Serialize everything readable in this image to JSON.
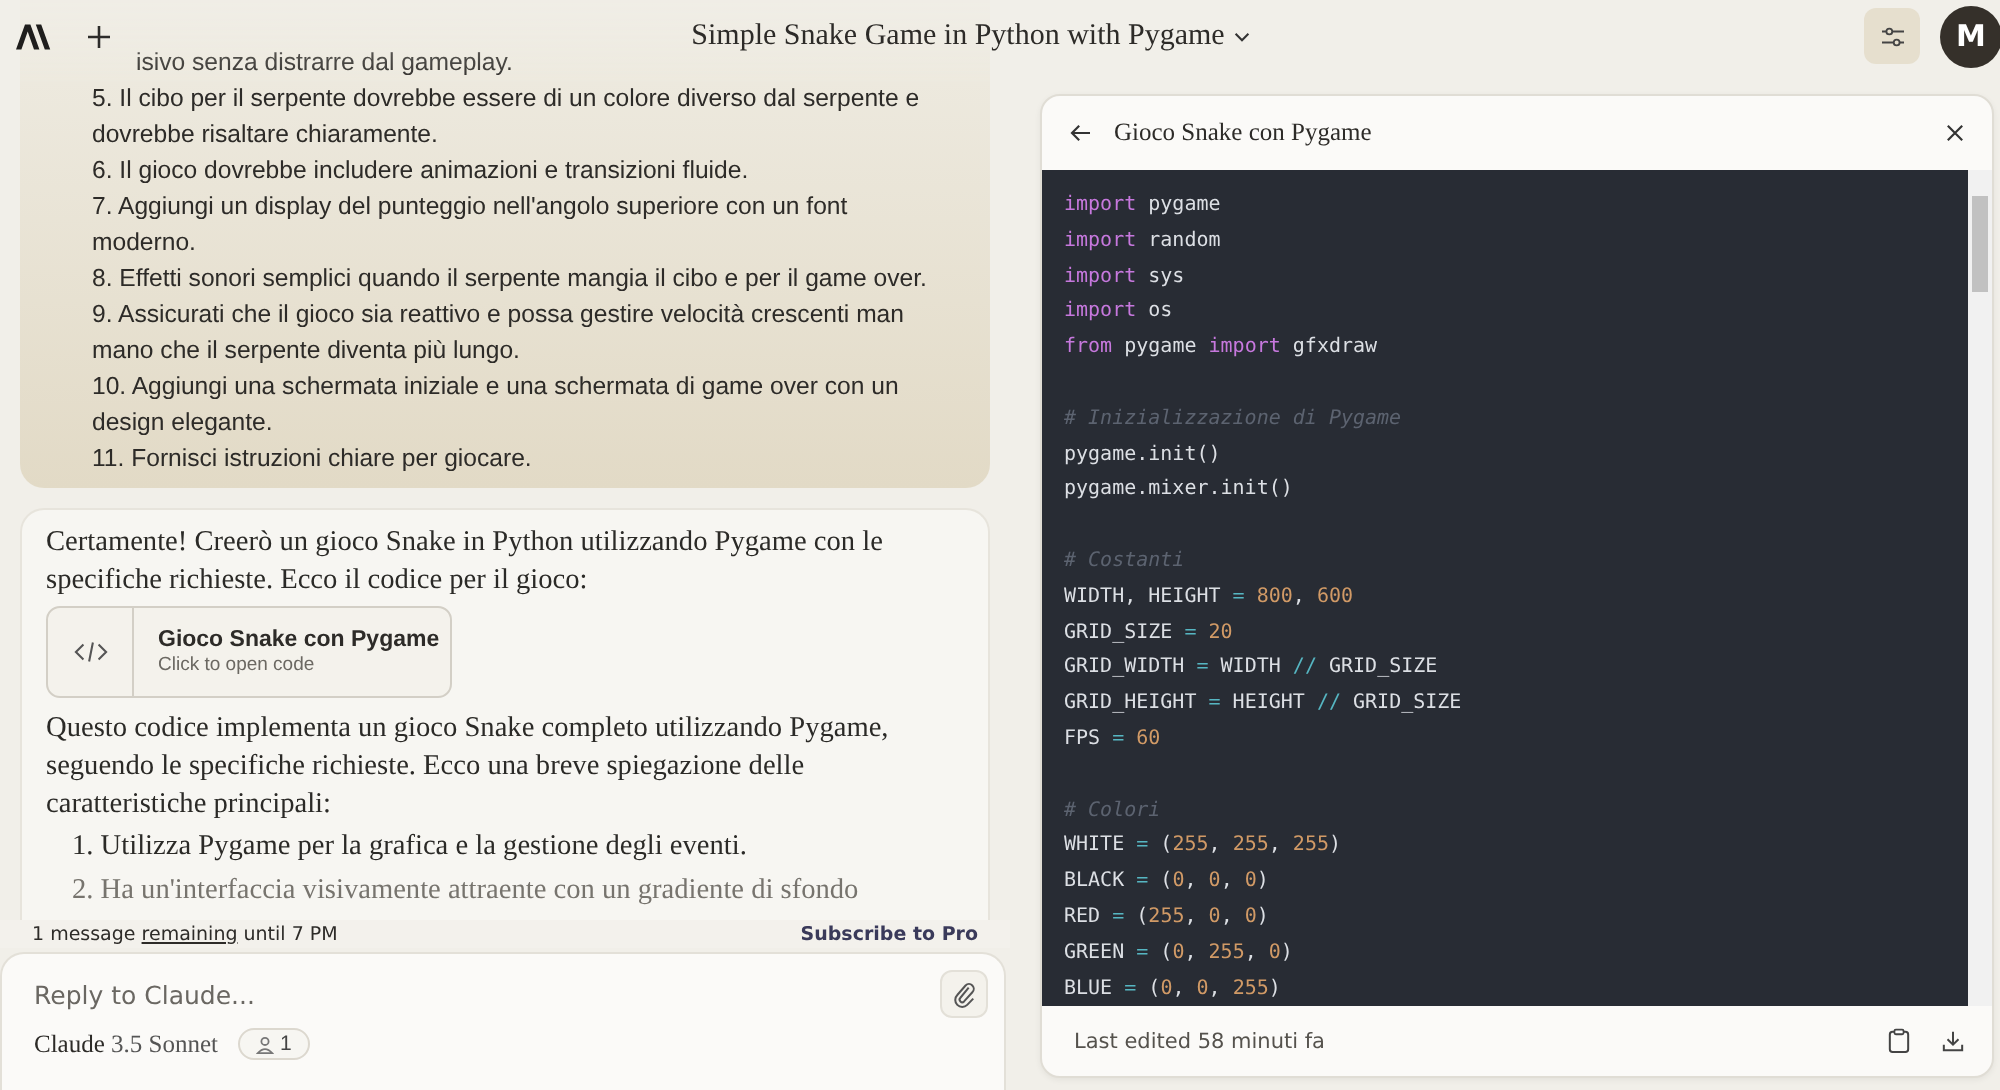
{
  "header": {
    "title": "Simple Snake Game in Python with Pygame",
    "avatar": "M"
  },
  "user_message": {
    "lines": [
      "isivo senza distrarre dal gameplay.",
      "5. Il cibo per il serpente dovrebbe essere di un colore diverso dal serpente e dovrebbe risaltare chiaramente.",
      "6. Il gioco dovrebbe includere animazioni e transizioni fluide.",
      "7. Aggiungi un display del punteggio nell'angolo superiore con un font moderno.",
      "8. Effetti sonori semplici quando il serpente mangia il cibo e per il game over.",
      "9. Assicurati che il gioco sia reattivo e possa gestire velocità crescenti man mano che il serpente diventa più lungo.",
      "10. Aggiungi una schermata iniziale e una schermata di game over con un design elegante.",
      "11. Fornisci istruzioni chiare per giocare."
    ]
  },
  "assistant_message": {
    "intro": "Certamente! Creerò un gioco Snake in Python utilizzando Pygame con le specifiche richieste. Ecco il codice per il gioco:",
    "artifact": {
      "title": "Gioco Snake con Pygame",
      "subtitle": "Click to open code"
    },
    "body": "Questo codice implementa un gioco Snake completo utilizzando Pygame, seguendo le specifiche richieste. Ecco una breve spiegazione delle caratteristiche principali:",
    "list": [
      "1. Utilizza Pygame per la grafica e la gestione degli eventi.",
      "2. Ha un'interfaccia visivamente attraente con un gradiente di sfondo"
    ]
  },
  "limit_notice": {
    "before": "1 message",
    "link": "remaining",
    "after": "until 7 PM",
    "action": "Subscribe to Pro"
  },
  "composer": {
    "placeholder": "Reply to Claude...",
    "model_name": "Claude",
    "model_version": "3.5 Sonnet",
    "count": "1"
  },
  "code_panel": {
    "title": "Gioco Snake con Pygame",
    "footer": "Last edited 58 minuti fa",
    "lines": [
      {
        "kind": "code",
        "tokens": [
          {
            "kind": "kw",
            "t": "import"
          },
          {
            "kind": "id",
            "t": " pygame"
          }
        ]
      },
      {
        "kind": "code",
        "tokens": [
          {
            "kind": "kw",
            "t": "import"
          },
          {
            "kind": "id",
            "t": " random"
          }
        ]
      },
      {
        "kind": "code",
        "tokens": [
          {
            "kind": "kw",
            "t": "import"
          },
          {
            "kind": "id",
            "t": " sys"
          }
        ]
      },
      {
        "kind": "code",
        "tokens": [
          {
            "kind": "kw",
            "t": "import"
          },
          {
            "kind": "id",
            "t": " os"
          }
        ]
      },
      {
        "kind": "code",
        "tokens": [
          {
            "kind": "kw",
            "t": "from"
          },
          {
            "kind": "id",
            "t": " pygame "
          },
          {
            "kind": "kw",
            "t": "import"
          },
          {
            "kind": "id",
            "t": " gfxdraw"
          }
        ]
      },
      {
        "kind": "blank"
      },
      {
        "kind": "code",
        "tokens": [
          {
            "kind": "cm",
            "t": "# Inizializzazione di Pygame"
          }
        ]
      },
      {
        "kind": "code",
        "tokens": [
          {
            "kind": "id",
            "t": "pygame.init()"
          }
        ]
      },
      {
        "kind": "code",
        "tokens": [
          {
            "kind": "id",
            "t": "pygame.mixer.init()"
          }
        ]
      },
      {
        "kind": "blank"
      },
      {
        "kind": "code",
        "tokens": [
          {
            "kind": "cm",
            "t": "# Costanti"
          }
        ]
      },
      {
        "kind": "code",
        "tokens": [
          {
            "kind": "id",
            "t": "WIDTH, HEIGHT "
          },
          {
            "kind": "op",
            "t": "="
          },
          {
            "kind": "num",
            "t": " 800"
          },
          {
            "kind": "id",
            "t": ", "
          },
          {
            "kind": "num",
            "t": "600"
          }
        ]
      },
      {
        "kind": "code",
        "tokens": [
          {
            "kind": "id",
            "t": "GRID_SIZE "
          },
          {
            "kind": "op",
            "t": "="
          },
          {
            "kind": "num",
            "t": " 20"
          }
        ]
      },
      {
        "kind": "code",
        "tokens": [
          {
            "kind": "id",
            "t": "GRID_WIDTH "
          },
          {
            "kind": "op",
            "t": "="
          },
          {
            "kind": "id",
            "t": " WIDTH "
          },
          {
            "kind": "op",
            "t": "//"
          },
          {
            "kind": "id",
            "t": " GRID_SIZE"
          }
        ]
      },
      {
        "kind": "code",
        "tokens": [
          {
            "kind": "id",
            "t": "GRID_HEIGHT "
          },
          {
            "kind": "op",
            "t": "="
          },
          {
            "kind": "id",
            "t": " HEIGHT "
          },
          {
            "kind": "op",
            "t": "//"
          },
          {
            "kind": "id",
            "t": " GRID_SIZE"
          }
        ]
      },
      {
        "kind": "code",
        "tokens": [
          {
            "kind": "id",
            "t": "FPS "
          },
          {
            "kind": "op",
            "t": "="
          },
          {
            "kind": "num",
            "t": " 60"
          }
        ]
      },
      {
        "kind": "blank"
      },
      {
        "kind": "code",
        "tokens": [
          {
            "kind": "cm",
            "t": "# Colori"
          }
        ]
      },
      {
        "kind": "code",
        "tokens": [
          {
            "kind": "id",
            "t": "WHITE "
          },
          {
            "kind": "op",
            "t": "="
          },
          {
            "kind": "id",
            "t": " ("
          },
          {
            "kind": "num",
            "t": "255"
          },
          {
            "kind": "id",
            "t": ", "
          },
          {
            "kind": "num",
            "t": "255"
          },
          {
            "kind": "id",
            "t": ", "
          },
          {
            "kind": "num",
            "t": "255"
          },
          {
            "kind": "id",
            "t": ")"
          }
        ]
      },
      {
        "kind": "code",
        "tokens": [
          {
            "kind": "id",
            "t": "BLACK "
          },
          {
            "kind": "op",
            "t": "="
          },
          {
            "kind": "id",
            "t": " ("
          },
          {
            "kind": "num",
            "t": "0"
          },
          {
            "kind": "id",
            "t": ", "
          },
          {
            "kind": "num",
            "t": "0"
          },
          {
            "kind": "id",
            "t": ", "
          },
          {
            "kind": "num",
            "t": "0"
          },
          {
            "kind": "id",
            "t": ")"
          }
        ]
      },
      {
        "kind": "code",
        "tokens": [
          {
            "kind": "id",
            "t": "RED "
          },
          {
            "kind": "op",
            "t": "="
          },
          {
            "kind": "id",
            "t": " ("
          },
          {
            "kind": "num",
            "t": "255"
          },
          {
            "kind": "id",
            "t": ", "
          },
          {
            "kind": "num",
            "t": "0"
          },
          {
            "kind": "id",
            "t": ", "
          },
          {
            "kind": "num",
            "t": "0"
          },
          {
            "kind": "id",
            "t": ")"
          }
        ]
      },
      {
        "kind": "code",
        "tokens": [
          {
            "kind": "id",
            "t": "GREEN "
          },
          {
            "kind": "op",
            "t": "="
          },
          {
            "kind": "id",
            "t": " ("
          },
          {
            "kind": "num",
            "t": "0"
          },
          {
            "kind": "id",
            "t": ", "
          },
          {
            "kind": "num",
            "t": "255"
          },
          {
            "kind": "id",
            "t": ", "
          },
          {
            "kind": "num",
            "t": "0"
          },
          {
            "kind": "id",
            "t": ")"
          }
        ]
      },
      {
        "kind": "code",
        "tokens": [
          {
            "kind": "id",
            "t": "BLUE "
          },
          {
            "kind": "op",
            "t": "="
          },
          {
            "kind": "id",
            "t": " ("
          },
          {
            "kind": "num",
            "t": "0"
          },
          {
            "kind": "id",
            "t": ", "
          },
          {
            "kind": "num",
            "t": "0"
          },
          {
            "kind": "id",
            "t": ", "
          },
          {
            "kind": "num",
            "t": "255"
          },
          {
            "kind": "id",
            "t": ")"
          }
        ]
      }
    ]
  }
}
